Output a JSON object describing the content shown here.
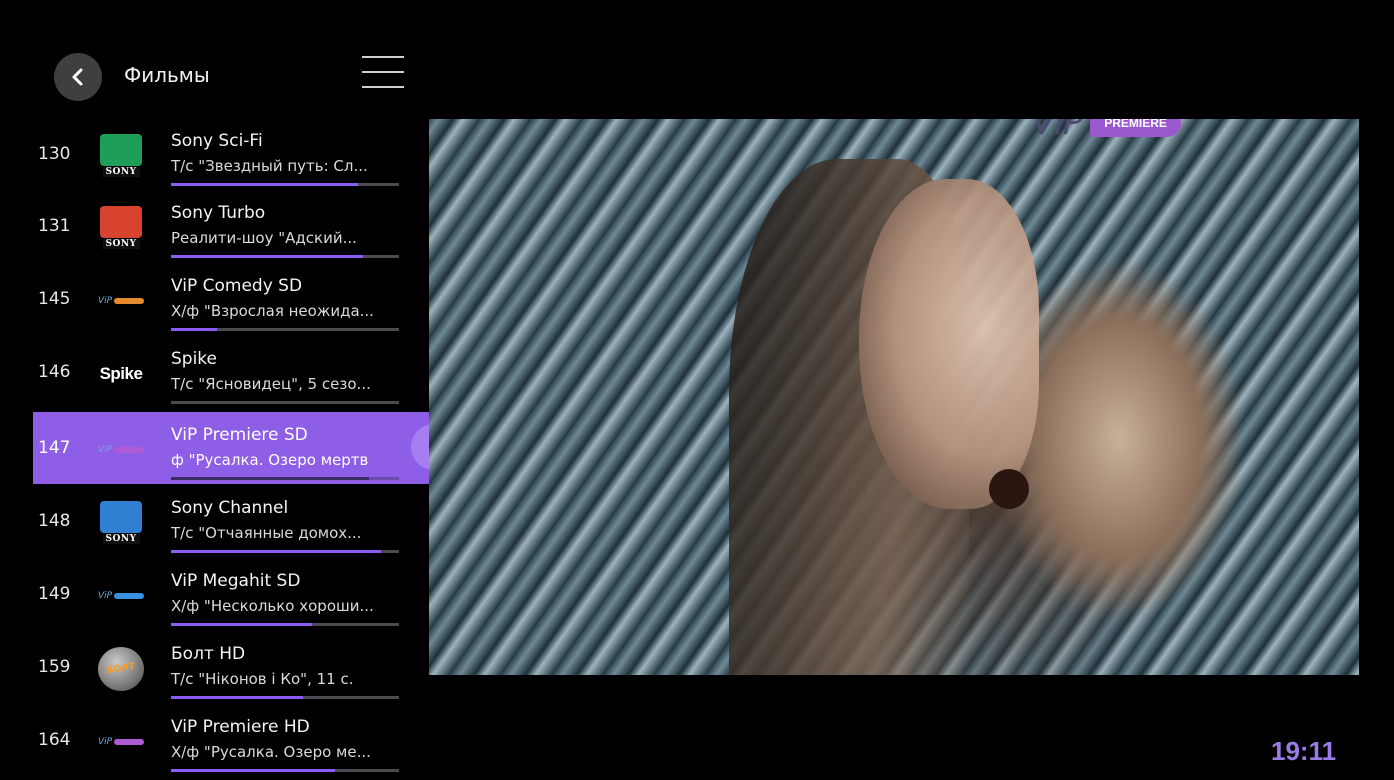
{
  "header": {
    "title": "Фильмы"
  },
  "channels": [
    {
      "number": "130",
      "name": "Sony Sci-Fi",
      "program": "Т/с \"Звездный путь: Сл...",
      "progress": 0.82,
      "logo": "sony-scifi-logo",
      "logo_color": "#1f9e57",
      "logo_word": "SONY"
    },
    {
      "number": "131",
      "name": "Sony Turbo",
      "program": "Реалити-шоу \"Адский...",
      "progress": 0.84,
      "logo": "sony-turbo-logo",
      "logo_color": "#d8432f",
      "logo_word": "SONY"
    },
    {
      "number": "145",
      "name": "ViP Comedy SD",
      "program": "Х/ф \"Взрослая неожида...",
      "progress": 0.2,
      "logo": "vip-comedy-logo",
      "logo_color": "#e68a2e"
    },
    {
      "number": "146",
      "name": "Spike",
      "program": "Т/с \"Ясновидец\", 5 сезо...",
      "progress": 0.0,
      "logo": "spike-logo",
      "logo_text": "Spike"
    },
    {
      "number": "147",
      "name": "ViP Premiere SD",
      "program": "ф \"Русалка. Озеро мертв",
      "progress": 0.87,
      "logo": "vip-premiere-logo",
      "logo_color": "#b05bd6",
      "selected": true
    },
    {
      "number": "148",
      "name": "Sony Channel",
      "program": "Т/с \"Отчаянные домох...",
      "progress": 0.92,
      "logo": "sony-channel-logo",
      "logo_color": "#2f7fd3",
      "logo_word": "SONY"
    },
    {
      "number": "149",
      "name": "ViP Megahit SD",
      "program": "Х/ф \"Несколько хороши...",
      "progress": 0.62,
      "logo": "vip-megahit-logo",
      "logo_color": "#3a8fe0"
    },
    {
      "number": "159",
      "name": "Болт HD",
      "program": "Т/с \"Ніконов і Ко\", 11 с.",
      "progress": 0.58,
      "logo": "bolt-logo",
      "logo_text": "БОЛТ"
    },
    {
      "number": "164",
      "name": "ViP Premiere HD",
      "program": "Х/ф \"Русалка. Озеро ме...",
      "progress": 0.72,
      "logo": "vip-premiere-logo",
      "logo_color": "#b05bd6"
    }
  ],
  "player": {
    "watermark_vip": "ViP",
    "watermark_premiere": "PREMIERE"
  },
  "clock": "19:11"
}
